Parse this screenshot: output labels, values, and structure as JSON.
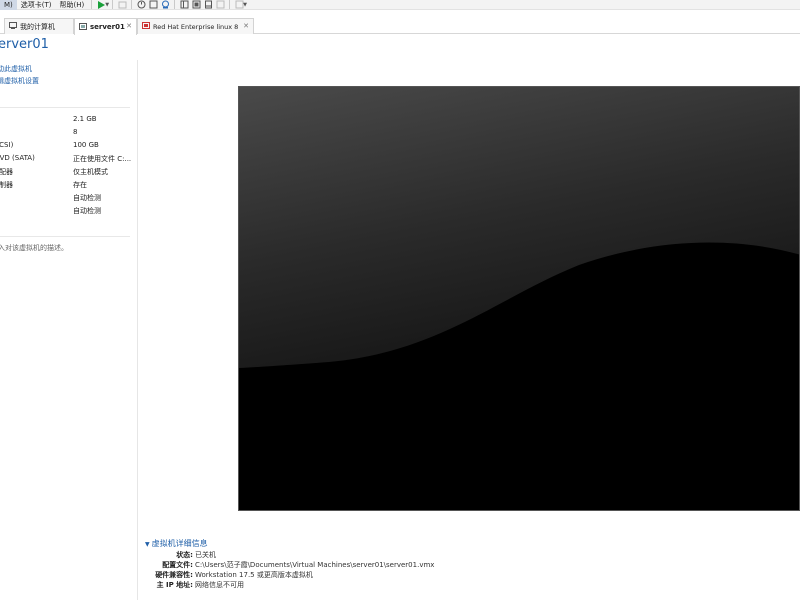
{
  "menu": {
    "items": [
      {
        "label": "M)",
        "active": true
      },
      {
        "label": "选项卡(T)",
        "active": false
      },
      {
        "label": "帮助(H)",
        "active": false
      }
    ]
  },
  "tabs": [
    {
      "label": "我的计算机",
      "icon": "computer-icon",
      "active": false
    },
    {
      "label": "server01",
      "icon": "vm-icon",
      "active": true
    },
    {
      "label": "Red Hat Enterprise linux 8",
      "icon": "vm-icon",
      "active": false
    }
  ],
  "vm": {
    "title": "erver01",
    "actions": [
      "动此虚拟机",
      "辑虚拟机设置"
    ],
    "devices": [
      {
        "name": "",
        "value": "2.1 GB"
      },
      {
        "name": "器",
        "value": "8"
      },
      {
        "name": "(SCSI)",
        "value": "100 GB"
      },
      {
        "name": "/DVD (SATA)",
        "value": "正在使用文件 C:..."
      },
      {
        "name": "适配器",
        "value": "仅主机模式"
      },
      {
        "name": "控制器",
        "value": "存在"
      },
      {
        "name": "",
        "value": "自动检测"
      },
      {
        "name": "",
        "value": "自动检测"
      }
    ],
    "description_placeholder": "入对该虚拟机的描述。"
  },
  "details": {
    "header": "虚拟机详细信息",
    "rows": [
      {
        "key": "状态:",
        "value": "已关机"
      },
      {
        "key": "配置文件:",
        "value": "C:\\Users\\范子霞\\Documents\\Virtual Machines\\server01\\server01.vmx"
      },
      {
        "key": "硬件兼容性:",
        "value": "Workstation 17.5 或更高版本虚拟机"
      },
      {
        "key": "主 IP 地址:",
        "value": "网络信息不可用"
      }
    ]
  },
  "colors": {
    "accent": "#1f5fa8",
    "play_green": "#1aa03a",
    "screen_bg": "#000000"
  }
}
